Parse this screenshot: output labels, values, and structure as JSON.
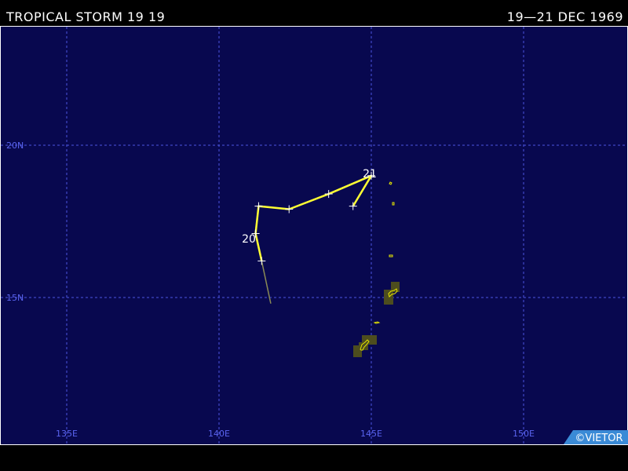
{
  "header": {
    "title": "TROPICAL STORM 19 19",
    "dates": "19—21 DEC 1969"
  },
  "map": {
    "colors": {
      "ocean": "#08084f",
      "grid": "#4b55e0",
      "label": "#5a64f0",
      "track": "#ffff33",
      "track_faint": "#8a8a55",
      "land_fill": "#4d4d1e",
      "land_outline": "#e6e600",
      "marker": "#ffffff",
      "credit_bg": "#3a8ad6"
    },
    "longitude_labels": [
      "135E",
      "140E",
      "145E",
      "150E"
    ],
    "latitude_labels": [
      "20N",
      "15N"
    ],
    "day_labels": [
      "20",
      "21"
    ],
    "credit": "©VIETOR"
  },
  "track_points": [
    {
      "lon": 141.7,
      "lat": 14.8,
      "kind": "forecast"
    },
    {
      "lon": 141.4,
      "lat": 16.2,
      "kind": "fix"
    },
    {
      "lon": 141.2,
      "lat": 17.1,
      "kind": "fix"
    },
    {
      "lon": 141.3,
      "lat": 18.0,
      "kind": "fix"
    },
    {
      "lon": 142.3,
      "lat": 17.9,
      "kind": "fix"
    },
    {
      "lon": 143.6,
      "lat": 18.4,
      "kind": "fix"
    },
    {
      "lon": 145.0,
      "lat": 19.0,
      "kind": "fix"
    },
    {
      "lon": 144.4,
      "lat": 18.0,
      "kind": "fix"
    }
  ]
}
